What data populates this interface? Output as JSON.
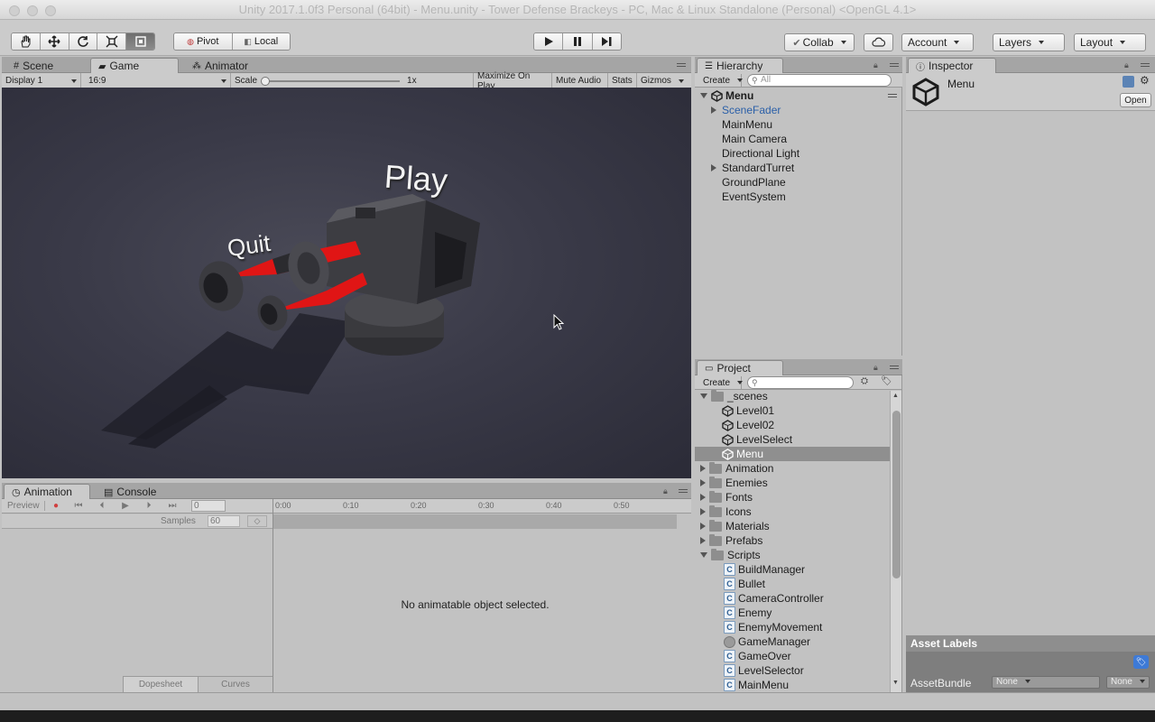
{
  "window": {
    "title": "Unity 2017.1.0f3 Personal (64bit) - Menu.unity - Tower Defense Brackeys - PC, Mac & Linux Standalone (Personal) <OpenGL 4.1>"
  },
  "toolbar": {
    "pivot_label": "Pivot",
    "local_label": "Local",
    "collab_label": "Collab",
    "account_label": "Account",
    "layers_label": "Layers",
    "layout_label": "Layout"
  },
  "scene_panel": {
    "tabs": [
      "Scene",
      "Game",
      "Animator"
    ],
    "display": "Display 1",
    "aspect": "16:9",
    "scale_label": "Scale",
    "scale_value": "1x",
    "buttons": [
      "Maximize On Play",
      "Mute Audio",
      "Stats",
      "Gizmos"
    ]
  },
  "game_view": {
    "play_text": "Play",
    "quit_text": "Quit"
  },
  "hierarchy": {
    "tab": "Hierarchy",
    "create": "Create",
    "search_placeholder": "All",
    "root": "Menu",
    "items": [
      "SceneFader",
      "MainMenu",
      "Main Camera",
      "Directional Light",
      "StandardTurret",
      "GroundPlane",
      "EventSystem"
    ]
  },
  "inspector": {
    "tab": "Inspector",
    "object_name": "Menu",
    "open_button": "Open",
    "asset_labels": "Asset Labels",
    "assetbundle_label": "AssetBundle",
    "assetbundle_value": "None",
    "variant_value": "None"
  },
  "project": {
    "tab": "Project",
    "create": "Create",
    "scenes_folder": "_scenes",
    "scenes": [
      "Level01",
      "Level02",
      "LevelSelect",
      "Menu"
    ],
    "folders": [
      "Animation",
      "Enemies",
      "Fonts",
      "Icons",
      "Materials",
      "Prefabs"
    ],
    "scripts_folder": "Scripts",
    "scripts": [
      "BuildManager",
      "Bullet",
      "CameraController",
      "Enemy",
      "EnemyMovement",
      "GameManager",
      "GameOver",
      "LevelSelector",
      "MainMenu"
    ]
  },
  "animation_panel": {
    "tabs": [
      "Animation",
      "Console"
    ],
    "preview": "Preview",
    "frame": "0",
    "samples_label": "Samples",
    "samples_value": "60",
    "timeline": [
      "0:00",
      "0:10",
      "0:20",
      "0:30",
      "0:40",
      "0:50"
    ],
    "empty_message": "No animatable object selected.",
    "bottom_tabs": [
      "Dopesheet",
      "Curves"
    ]
  }
}
